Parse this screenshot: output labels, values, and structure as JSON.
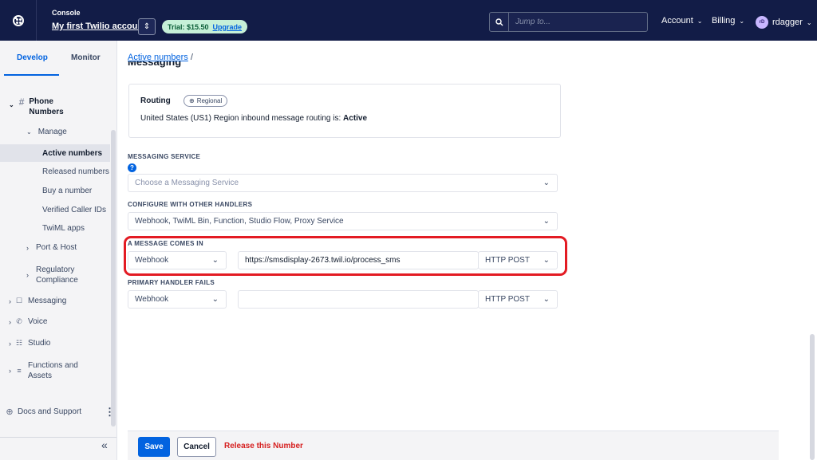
{
  "topbar": {
    "console_label": "Console",
    "account_name": "My first Twilio account",
    "trial_text": "Trial: $15.50",
    "upgrade_label": "Upgrade",
    "search_placeholder": "Jump to...",
    "account_menu": "Account",
    "billing_menu": "Billing",
    "avatar_initials": "rD",
    "user_name": "rdagger"
  },
  "sidebar": {
    "tabs": [
      {
        "label": "Develop",
        "active": true
      },
      {
        "label": "Monitor",
        "active": false
      }
    ],
    "phone_numbers": "Phone Numbers",
    "manage": "Manage",
    "sub_items": [
      "Active numbers",
      "Released numbers",
      "Buy a number",
      "Verified Caller IDs",
      "TwiML apps"
    ],
    "port_host": "Port & Host",
    "regulatory": "Regulatory Compliance",
    "products": [
      "Messaging",
      "Voice",
      "Studio",
      "Functions and Assets"
    ],
    "docs_support": "Docs and Support",
    "collapse_glyph": "«"
  },
  "main": {
    "breadcrumb_link": "Active numbers",
    "breadcrumb_sep": " /",
    "cut_heading": "Messaging",
    "routing": {
      "title": "Routing",
      "badge": "Regional",
      "text_prefix": "United States (US1) Region inbound message routing is: ",
      "status": "Active"
    },
    "messaging_service": {
      "label": "MESSAGING SERVICE",
      "placeholder": "Choose a Messaging Service"
    },
    "other_handlers": {
      "label": "CONFIGURE WITH OTHER HANDLERS",
      "value": "Webhook, TwiML Bin, Function, Studio Flow, Proxy Service"
    },
    "message_comes_in": {
      "label": "A MESSAGE COMES IN",
      "handler": "Webhook",
      "url": "https://smsdisplay-2673.twil.io/process_sms",
      "method": "HTTP POST"
    },
    "primary_handler_fails": {
      "label": "PRIMARY HANDLER FAILS",
      "handler": "Webhook",
      "url": "",
      "method": "HTTP POST"
    }
  },
  "footer": {
    "save": "Save",
    "cancel": "Cancel",
    "release": "Release this Number"
  },
  "colors": {
    "topbar_bg": "#121c47",
    "accent": "#0263e0",
    "highlight": "#e31b23",
    "danger": "#d61f1f",
    "trial_bg": "#c6f0d8"
  }
}
